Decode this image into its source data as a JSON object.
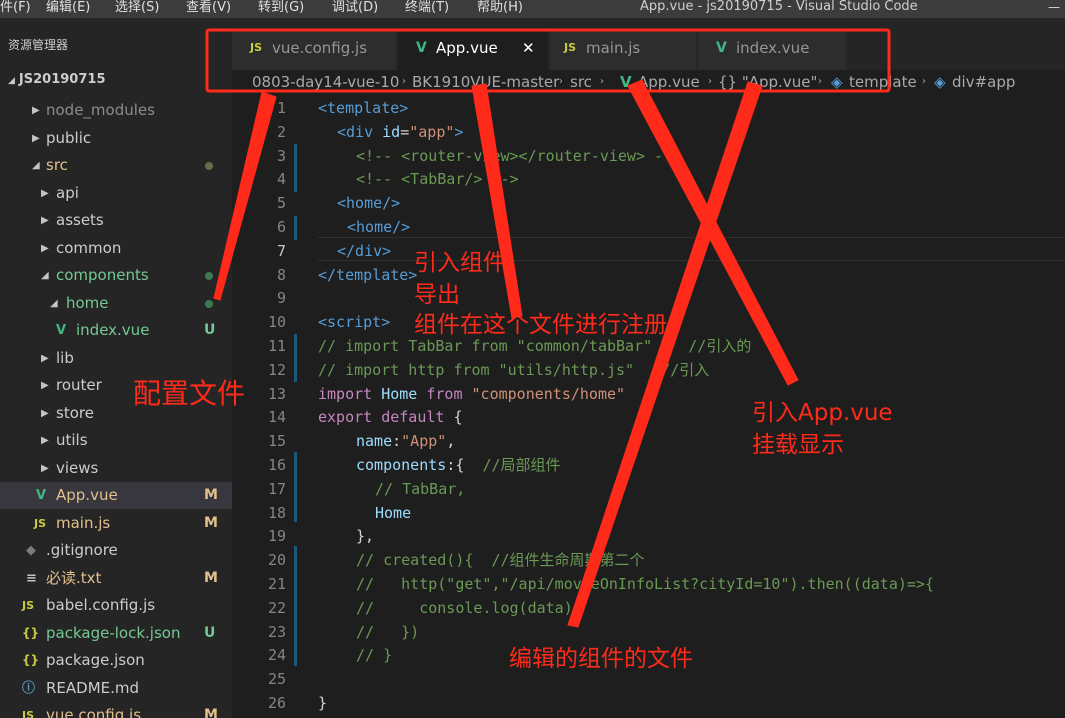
{
  "menu": {
    "items": [
      "件(F)",
      "编辑(E)",
      "选择(S)",
      "查看(V)",
      "转到(G)",
      "调试(D)",
      "终端(T)",
      "帮助(H)"
    ],
    "window_title": "App.vue - js20190715 - Visual Studio Code"
  },
  "sidebar": {
    "title": "资源管理器",
    "project": "JS20190715",
    "items": [
      {
        "label": "node_modules",
        "status": ""
      },
      {
        "label": "public",
        "status": ""
      },
      {
        "label": "src",
        "status": "dot"
      },
      {
        "label": "api",
        "status": ""
      },
      {
        "label": "assets",
        "status": ""
      },
      {
        "label": "common",
        "status": ""
      },
      {
        "label": "components",
        "status": "dot"
      },
      {
        "label": "home",
        "status": "dot"
      },
      {
        "label": "index.vue",
        "status": "U"
      },
      {
        "label": "lib",
        "status": ""
      },
      {
        "label": "router",
        "status": ""
      },
      {
        "label": "store",
        "status": ""
      },
      {
        "label": "utils",
        "status": ""
      },
      {
        "label": "views",
        "status": ""
      },
      {
        "label": "App.vue",
        "status": "M"
      },
      {
        "label": "main.js",
        "status": "M"
      },
      {
        "label": ".gitignore",
        "status": ""
      },
      {
        "label": "必读.txt",
        "status": "M"
      },
      {
        "label": "babel.config.js",
        "status": ""
      },
      {
        "label": "package-lock.json",
        "status": "U"
      },
      {
        "label": "package.json",
        "status": ""
      },
      {
        "label": "README.md",
        "status": ""
      },
      {
        "label": "vue.config.js",
        "status": "M"
      }
    ]
  },
  "tabs": [
    {
      "label": "vue.config.js",
      "icon": "JS"
    },
    {
      "label": "App.vue",
      "icon": "V",
      "close": "✕"
    },
    {
      "label": "main.js",
      "icon": "JS"
    },
    {
      "label": "index.vue",
      "icon": "V"
    }
  ],
  "breadcrumb": [
    "0803-day14-vue-10",
    "BK1910VUE-master",
    "src",
    "App.vue",
    "{} \"App.vue\"",
    "template",
    "div#app"
  ],
  "editor": {
    "line_numbers": [
      "1",
      "2",
      "3",
      "4",
      "5",
      "6",
      "7",
      "8",
      "9",
      "10",
      "11",
      "12",
      "13",
      "14",
      "15",
      "16",
      "17",
      "18",
      "19",
      "20",
      "21",
      "22",
      "23",
      "24",
      "25",
      "26"
    ],
    "code": {
      "l1": "<template>",
      "l2_tag": "<div ",
      "l2_attr": "id",
      "l2_eq": "=",
      "l2_str": "\"app\"",
      "l2_end": ">",
      "l3": "<!-- <router-view></router-view> -->",
      "l4": "<!-- <TabBar/> -->",
      "l5": "<home/>",
      "l6": "<home/>",
      "l7": "</div>",
      "l8": "</template>",
      "l10": "<script>",
      "l11": "// import TabBar from \"common/tabBar\"    //引入的",
      "l12": "// import http from \"utils/http.js\"   //引入",
      "l13_kw": "import ",
      "l13_id": "Home ",
      "l13_kw2": "from ",
      "l13_str": "\"components/home\"",
      "l14_kw": "export default ",
      "l14_b": "{",
      "l15_k": "name",
      "l15_c": ":",
      "l15_s": "\"App\"",
      "l15_e": ",",
      "l16_k": "components",
      "l16_c": ":{  ",
      "l16_cm": "//局部组件",
      "l17": "// TabBar,",
      "l18": "Home",
      "l19": "},",
      "l20": "// created(){  //组件生命周期第二个",
      "l21": "//   http(\"get\",\"/api/movieOnInfoList?cityId=10\").then((data)=>{",
      "l22": "//     console.log(data);",
      "l23": "//   })",
      "l24": "// }",
      "l26": "}"
    }
  },
  "annotations": {
    "config": "配置文件",
    "app_line1": "引入组件",
    "app_line2": "导出",
    "app_line3": "组件在这个文件进行注册",
    "main_line1": "引入App.vue",
    "main_line2": "挂载显示",
    "index": "编辑的组件的文件"
  },
  "colors": {
    "annotation": "#ff2a1a",
    "vue_icon": "#41b883",
    "js_icon": "#cbcb41",
    "modified": "#e2c08d",
    "untracked": "#73c991"
  }
}
